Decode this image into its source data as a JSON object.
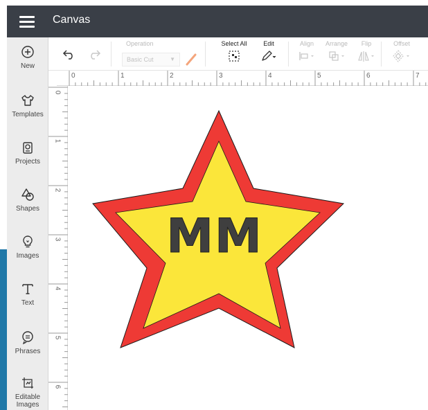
{
  "header": {
    "title": "Canvas"
  },
  "sidebar": {
    "items": [
      {
        "label": "New",
        "icon": "plus-circle-icon"
      },
      {
        "label": "Templates",
        "icon": "shirt-icon"
      },
      {
        "label": "Projects",
        "icon": "projects-icon"
      },
      {
        "label": "Shapes",
        "icon": "shapes-icon"
      },
      {
        "label": "Images",
        "icon": "lightbulb-icon"
      },
      {
        "label": "Text",
        "icon": "text-icon"
      },
      {
        "label": "Phrases",
        "icon": "speech-bubble-icon"
      },
      {
        "label": "Editable Images",
        "icon": "editable-image-icon"
      }
    ]
  },
  "toolbar": {
    "operation_label": "Operation",
    "operation_value": "Basic Cut",
    "select_all_label": "Select All",
    "edit_label": "Edit",
    "align_label": "Align",
    "arrange_label": "Arrange",
    "flip_label": "Flip",
    "offset_label": "Offset"
  },
  "ruler": {
    "horizontal": [
      "0",
      "1",
      "2",
      "3",
      "4",
      "5",
      "6",
      "7"
    ],
    "vertical": [
      "0",
      "1",
      "2",
      "3",
      "4",
      "5",
      "6"
    ]
  },
  "design": {
    "text": "MM",
    "outer_color": "#ee3a35",
    "inner_color": "#fbe63a",
    "text_color": "#3f3f3f"
  }
}
